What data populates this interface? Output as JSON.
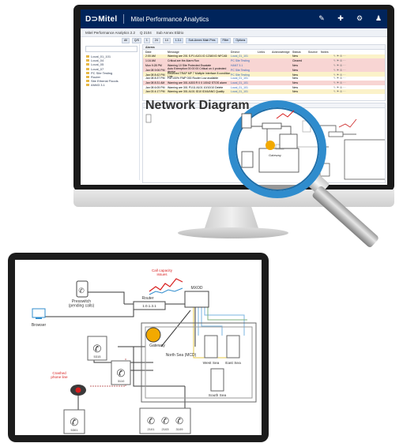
{
  "brand": {
    "logo": "D⊃Mitel",
    "title": "Mitel Performance Analytics"
  },
  "topbar": {
    "icons": [
      "wrench-icon",
      "plus-icon",
      "gear-icon",
      "user-icon"
    ]
  },
  "breadcrumb": [
    "Mitel Performance Analytics 2.2",
    "Q 2104",
    "Sub Annex Eldrio"
  ],
  "filters": [
    "All",
    "Q/S",
    "1",
    "24",
    "14",
    "1.3.1",
    "Sub-Annex Main Pres",
    "Filter",
    "Options"
  ],
  "sidebar": {
    "items": [
      "Local_01_101",
      "Local_04",
      "Local_05",
      "Local_07",
      "PC Site Testing",
      "Router",
      "Site Etherial Floods",
      "ANM3 3.1"
    ]
  },
  "alarms": {
    "title": "Alarms",
    "columns": [
      "Date",
      "Message",
      "Device",
      "Links",
      "Acknowledge",
      "Status",
      "Source",
      "Notes"
    ],
    "rows": [
      {
        "date": "2:00 AM",
        "message": "Warning are 201 S.P1 A101 ID 12345 ID NFCA5",
        "device": "Local_01_101",
        "status": "New",
        "hl": "yel"
      },
      {
        "date": "1:16 AM",
        "message": "Critical are the Alarm Run",
        "device": "PC Site Testing",
        "status": "Cleared",
        "hl": "pink"
      },
      {
        "date": "Mon 9:28 PM",
        "message": "Warning 10 Site Protected Escalate",
        "device": "HANT 3.1",
        "status": "New",
        "hl": "pink"
      },
      {
        "date": "Jan 08 9:06 PM",
        "message": "Auto Exemption 00 00 00 Critical on 4 protected device",
        "device": "PC Site Testing",
        "status": "New",
        "hl": "pink"
      },
      {
        "date": "Jan 08 8:42 PM",
        "message": "Received TRAP MP 7 Multiple Interface 8 condition Link",
        "device": "PC Site Testing",
        "status": "New",
        "hl": "yel"
      },
      {
        "date": "Jan 08 8:37 PM",
        "message": "Fut 100% FWP 000 Router Low available",
        "device": "Local_01_101",
        "status": "New",
        "hl": ""
      },
      {
        "date": "Jan 08 8:31 AM",
        "message": "Warning are 301 A303 R 0 0 10042 STOS alarm",
        "device": "Local_01_101",
        "status": "New",
        "hl": "pink"
      },
      {
        "date": "Jan 08 6:05 PM",
        "message": "Warning are 301 P1/11 A101 10/10/10 Delete",
        "device": "Local_01_101",
        "status": "New",
        "hl": ""
      },
      {
        "date": "Jan 03 4:17 PM",
        "message": "Warning are 301 A101 ID10 ID16/ANG Quality",
        "device": "Local_01_101",
        "status": "New",
        "hl": "yel"
      }
    ]
  },
  "network_diagram": {
    "title": "Network Diagram"
  },
  "tablet_diagram": {
    "call_capacity": "Call capacity\nissues",
    "router": "Router",
    "router_display": "1.0.1.3.1",
    "presswitch": "Presswitch\n(pending calls)",
    "browser": "Browser",
    "mxod": "MXOD",
    "gateway": "Gateway",
    "north_sea": "North Sea (MCD)",
    "west_sea": "West Sea",
    "east_sea": "East Sea",
    "south_sea": "South Sea",
    "crashed": "Crashed\nphone line",
    "ext_top": "5315",
    "ext_mid": "3110",
    "ext_bottom": "5301",
    "ext_row": [
      "2101",
      "2103",
      "3109"
    ],
    "colors": {
      "accent": "#2f8ccd",
      "navy": "#00245b",
      "red": "#d81e1e",
      "orange": "#f2a900"
    }
  }
}
